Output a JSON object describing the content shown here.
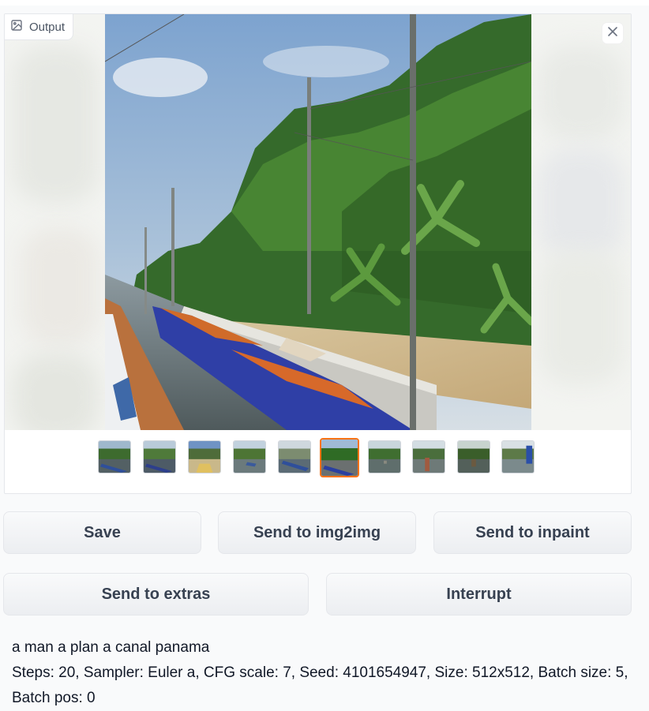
{
  "gallery": {
    "label": "Output",
    "label_icon": "image-icon",
    "close_icon": "close-icon",
    "selected_index": 5,
    "thumbnails": [
      {
        "name": "thumb-1",
        "sky": "#9fb8cc",
        "trees": "#3d6b2e",
        "water": "#536064",
        "boat": "#2f4f9a"
      },
      {
        "name": "thumb-2",
        "sky": "#b9cbd9",
        "trees": "#4f7a3a",
        "water": "#4d5b66",
        "boat": "#2d3f8c"
      },
      {
        "name": "thumb-3",
        "sky": "#6f93c4",
        "trees": "#4e6c3a",
        "water": "#c9b88a",
        "boat": "#e0c060"
      },
      {
        "name": "thumb-4",
        "sky": "#c2d2de",
        "trees": "#4d7535",
        "water": "#6b7a7c",
        "boat": "#3a5a9c"
      },
      {
        "name": "thumb-5",
        "sky": "#cfd8de",
        "trees": "#7c8c70",
        "water": "#5b6b75",
        "boat": "#2f4f9a"
      },
      {
        "name": "thumb-6",
        "sky": "#9fbad6",
        "trees": "#2f6b25",
        "water": "#6b7070",
        "boat": "#2a3fa0"
      },
      {
        "name": "thumb-7",
        "sky": "#c9d6dc",
        "trees": "#3f6e30",
        "water": "#5f6e6c",
        "boat": "#8a8a80"
      },
      {
        "name": "thumb-8",
        "sky": "#d3dde2",
        "trees": "#4a6e3c",
        "water": "#6e7a78",
        "boat": "#a05a40"
      },
      {
        "name": "thumb-9",
        "sky": "#c8d4cf",
        "trees": "#3a5e2a",
        "water": "#53605a",
        "boat": "#6b5a40"
      },
      {
        "name": "thumb-10",
        "sky": "#d9e0e4",
        "trees": "#5d7a48",
        "water": "#7b8a8c",
        "boat": "#2a4fa8"
      }
    ]
  },
  "buttons": {
    "save": "Save",
    "send_img2img": "Send to img2img",
    "send_inpaint": "Send to inpaint",
    "send_extras": "Send to extras",
    "interrupt": "Interrupt"
  },
  "generation_info": {
    "prompt": "a man a plan a canal panama",
    "params": "Steps: 20, Sampler: Euler a, CFG scale: 7, Seed: 4101654947, Size: 512x512, Batch size: 5, Batch pos: 0"
  },
  "colors": {
    "selected_border": "#f97316",
    "button_text": "#374151"
  }
}
